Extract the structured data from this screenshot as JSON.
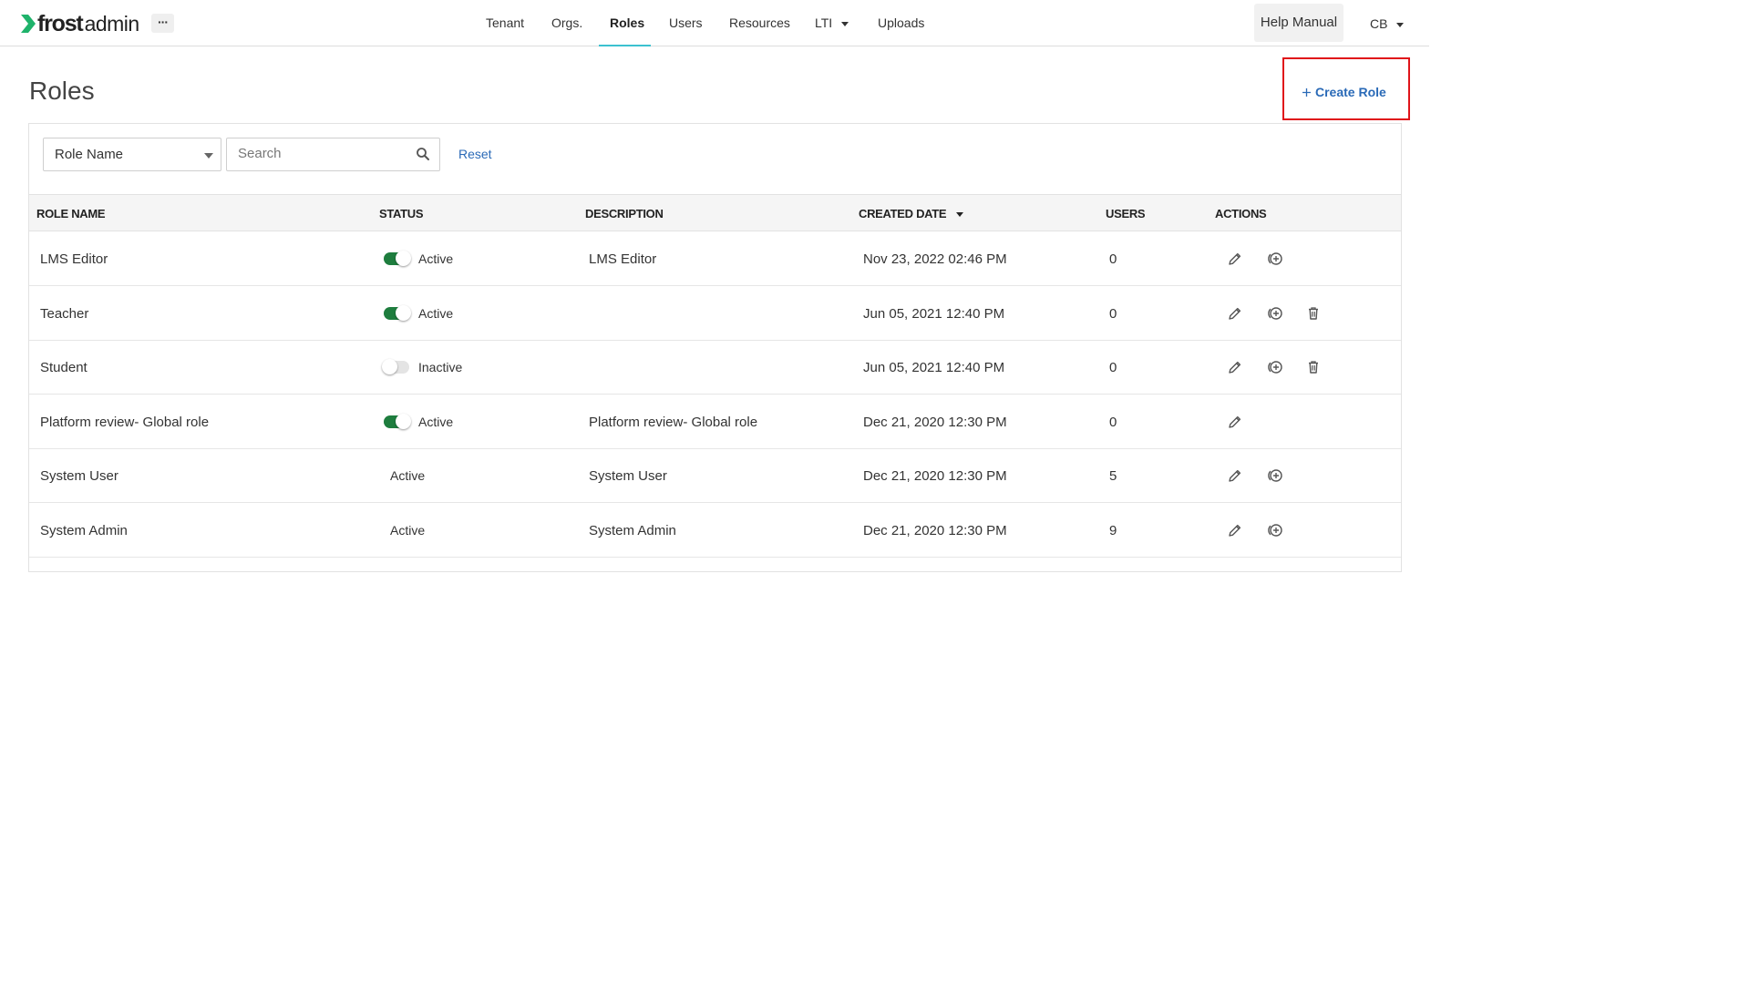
{
  "brand": {
    "name_bold": "frost",
    "name_light": "admin",
    "accent": "#1fb36b"
  },
  "header": {
    "more_label": "···",
    "nav": [
      {
        "label": "Tenant"
      },
      {
        "label": "Orgs."
      },
      {
        "label": "Roles",
        "active": true
      },
      {
        "label": "Users"
      },
      {
        "label": "Resources"
      },
      {
        "label": "LTI"
      },
      {
        "label": "Uploads"
      }
    ],
    "help_label": "Help Manual",
    "user_initials": "CB"
  },
  "page": {
    "title": "Roles",
    "create_label": "Create Role",
    "create_icon": "plus-icon"
  },
  "filters": {
    "field_selected": "Role Name",
    "search_placeholder": "Search",
    "search_value": "",
    "reset_label": "Reset"
  },
  "table": {
    "columns": [
      "ROLE NAME",
      "STATUS",
      "DESCRIPTION",
      "CREATED DATE",
      "USERS",
      "ACTIONS"
    ],
    "sort": {
      "column": "CREATED DATE",
      "direction": "desc"
    },
    "rows": [
      {
        "name": "LMS Editor",
        "status": "Active",
        "toggle": "on",
        "description": "LMS Editor",
        "created": "Nov 23, 2022 02:46 PM",
        "users": "0",
        "actions": [
          "edit-icon",
          "add-permission-icon"
        ]
      },
      {
        "name": "Teacher",
        "status": "Active",
        "toggle": "on",
        "description": "",
        "created": "Jun 05, 2021 12:40 PM",
        "users": "0",
        "actions": [
          "edit-icon",
          "add-permission-icon",
          "delete-icon"
        ]
      },
      {
        "name": "Student",
        "status": "Inactive",
        "toggle": "off",
        "description": "",
        "created": "Jun 05, 2021 12:40 PM",
        "users": "0",
        "actions": [
          "edit-icon",
          "add-permission-icon",
          "delete-icon"
        ]
      },
      {
        "name": "Platform review- Global role",
        "status": "Active",
        "toggle": "on",
        "description": "Platform review- Global role",
        "created": "Dec 21, 2020 12:30 PM",
        "users": "0",
        "actions": [
          "edit-icon"
        ]
      },
      {
        "name": "System User",
        "status": "Active",
        "toggle": "none",
        "description": "System User",
        "created": "Dec 21, 2020 12:30 PM",
        "users": "5",
        "actions": [
          "edit-icon",
          "add-permission-icon"
        ]
      },
      {
        "name": "System Admin",
        "status": "Active",
        "toggle": "none",
        "description": "System Admin",
        "created": "Dec 21, 2020 12:30 PM",
        "users": "9",
        "actions": [
          "edit-icon",
          "add-permission-icon"
        ]
      }
    ]
  },
  "colors": {
    "link": "#2a6ab7",
    "toggle_on": "#1e7d3e",
    "nav_active_underline": "#3cc1d0",
    "highlight_box": "#e0141a"
  }
}
